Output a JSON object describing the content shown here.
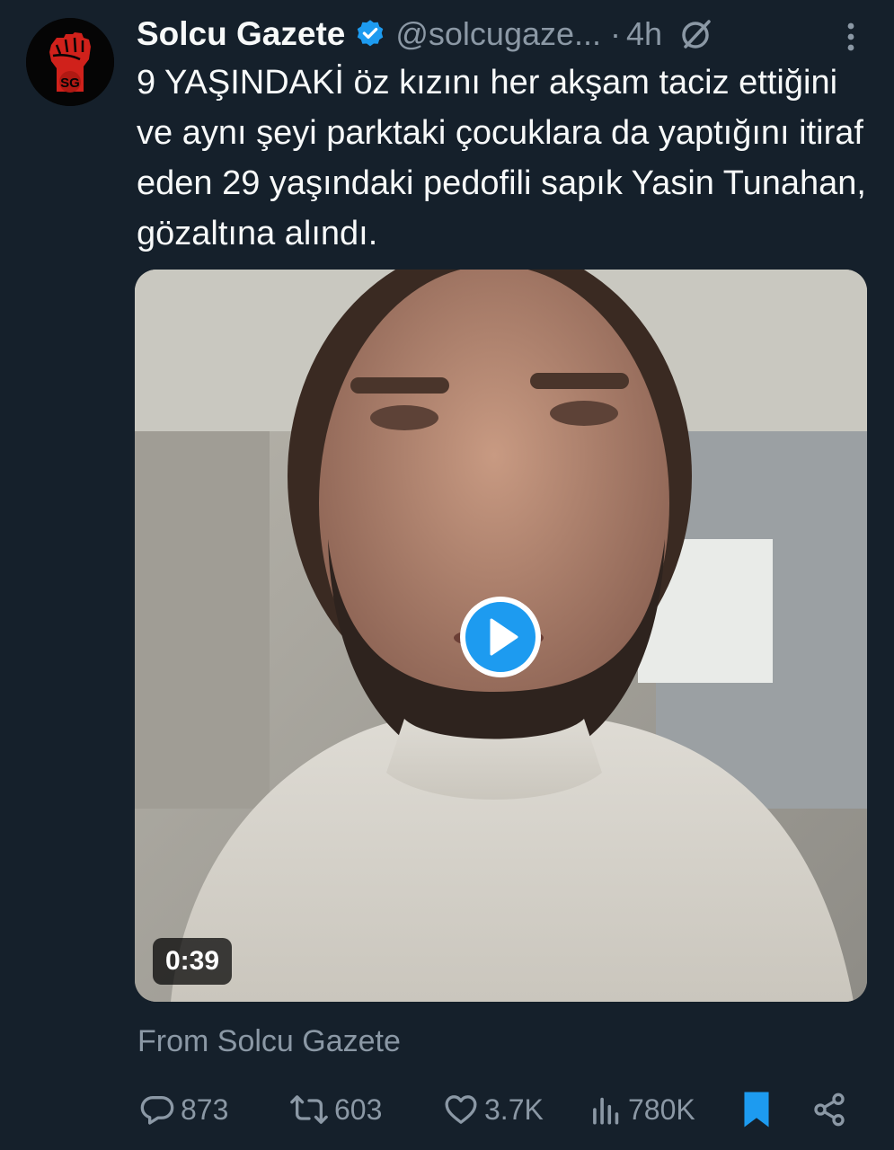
{
  "tweet": {
    "author": {
      "display_name": "Solcu Gazete",
      "handle": "@solcugaze...",
      "avatar_text": "SG",
      "verified": true
    },
    "separator": "·",
    "time": "4h",
    "text": "9 YAŞINDAKİ öz kızını her akşam taciz ettiğini ve aynı şeyi parktaki çocuklara da yaptığını itiraf eden 29 yaşındaki pedofili sapık Yasin Tunahan, gözaltına alındı.",
    "media": {
      "type": "video",
      "duration": "0:39"
    },
    "from_label": "From Solcu Gazete",
    "metrics": {
      "replies": "873",
      "reposts": "603",
      "likes": "3.7K",
      "views": "780K"
    }
  },
  "colors": {
    "background": "#15202b",
    "accent": "#1d9bf0",
    "text_primary": "#f7f9f9",
    "text_secondary": "#8b98a5",
    "avatar_fist": "#d0211b"
  },
  "icons": {
    "verified": "verified-badge-icon",
    "grok": "grok-icon",
    "more": "more-options-icon",
    "play": "play-icon",
    "reply": "reply-icon",
    "repost": "repost-icon",
    "like": "like-icon",
    "views": "views-icon",
    "bookmark": "bookmark-icon",
    "share": "share-icon"
  }
}
